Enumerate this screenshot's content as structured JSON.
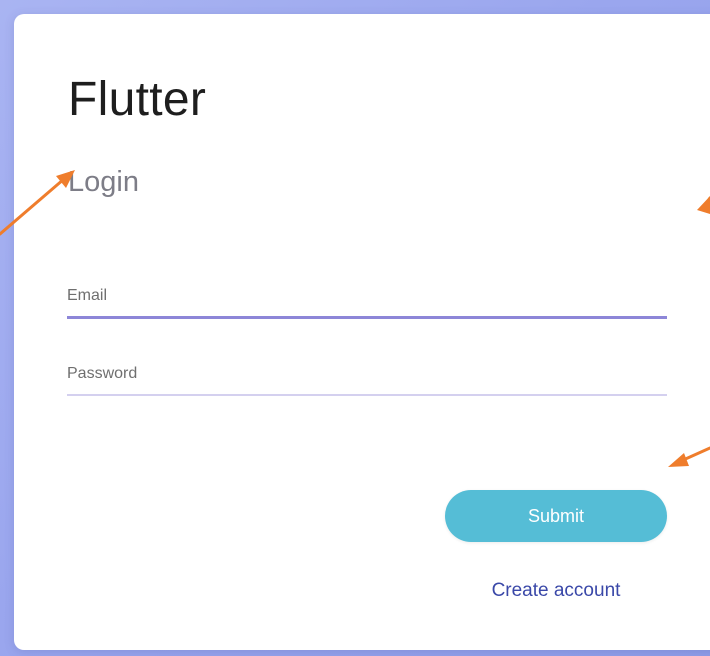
{
  "header": {
    "title": "Flutter",
    "subtitle": "Login"
  },
  "form": {
    "email_placeholder": "Email",
    "email_value": "",
    "password_placeholder": "Password",
    "password_value": "",
    "submit_label": "Submit",
    "create_account_label": "Create account"
  },
  "colors": {
    "background": "#9aa6ee",
    "accent": "#55bdd6",
    "focus_underline": "#8d86d8",
    "link": "#3a48a8",
    "annotation_arrow": "#ef7d2c"
  }
}
